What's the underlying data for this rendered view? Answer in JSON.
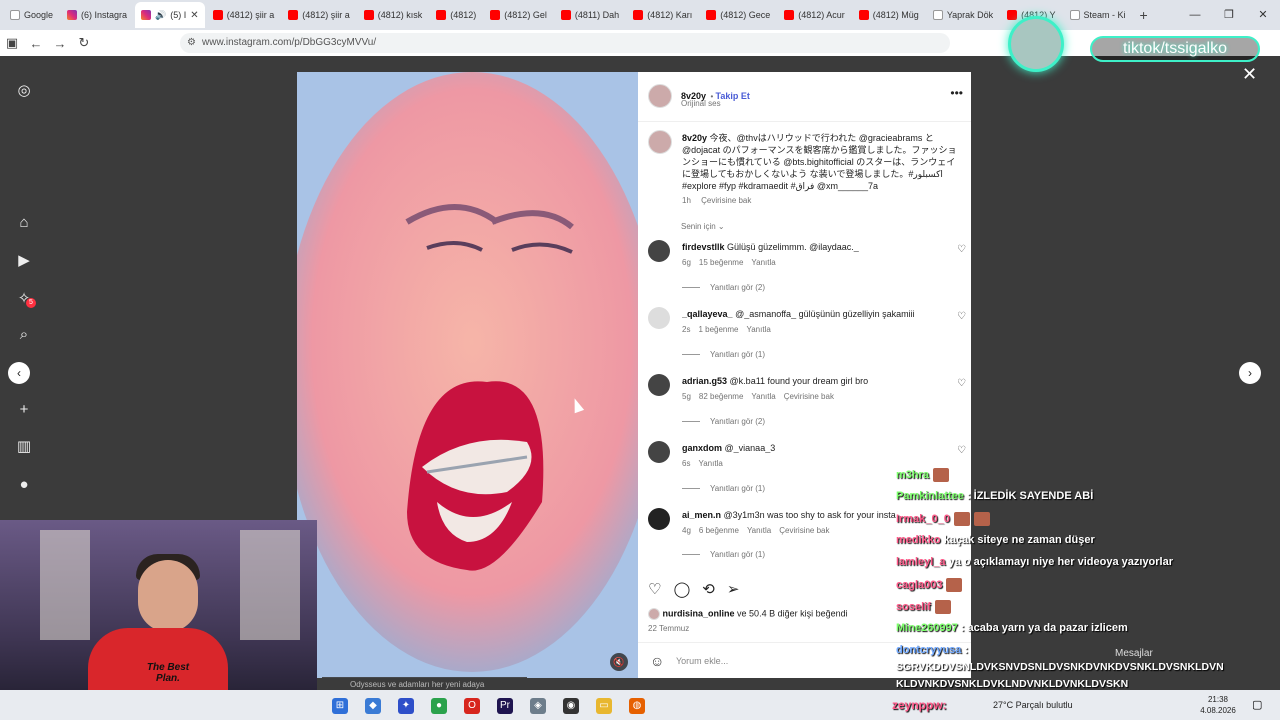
{
  "browser": {
    "tabs": [
      {
        "label": "Google",
        "icon": "google"
      },
      {
        "label": "(6) Instagra",
        "icon": "instagram"
      },
      {
        "label": "(5) I",
        "icon": "instagram",
        "active": true
      },
      {
        "label": "(4812) şiir a",
        "icon": "youtube"
      },
      {
        "label": "(4812) şiir a",
        "icon": "youtube"
      },
      {
        "label": "(4812) kısk",
        "icon": "youtube"
      },
      {
        "label": "(4812)",
        "icon": "youtube"
      },
      {
        "label": "(4812) Gel",
        "icon": "youtube"
      },
      {
        "label": "(4811) Dah",
        "icon": "youtube"
      },
      {
        "label": "(4812) Karı",
        "icon": "youtube"
      },
      {
        "label": "(4812) Gece",
        "icon": "youtube"
      },
      {
        "label": "(4812) Acur",
        "icon": "youtube"
      },
      {
        "label": "(4812) Müg",
        "icon": "youtube"
      },
      {
        "label": "Yaprak Dök",
        "icon": "web"
      },
      {
        "label": "(4812) Y",
        "icon": "youtube"
      },
      {
        "label": "Steam - Ki",
        "icon": "web"
      }
    ],
    "url": "www.instagram.com/p/DbGG3cyMVVu/"
  },
  "post": {
    "username": "8v20y",
    "follow_label": "Takip Et",
    "audio": "Orijinal ses",
    "caption_user": "8v20y",
    "caption": "今夜、@thvはハリウッドで行われた @gracieabrams と @dojacat のパフォーマンスを観客席から鑑賞しました。ファッションショーにも慣れている @bts.bighitofficial のスターは、ランウェイに登場してもおかしくないよう な装いで登場しました。#اكسبلور #explore #fyp #kdramaedit #فراق @xm______7a",
    "caption_time": "1h",
    "translate_label": "Çevirisine bak",
    "sort_label": "Senin için",
    "likes_user": "nurdisina_online",
    "likes_text": "ve 50.4 B diğer kişi beğendi",
    "date": "22 Temmuz",
    "add_comment_placeholder": "Yorum ekle..."
  },
  "comments": [
    {
      "user": "firdevstllk",
      "text": "Gülüşü güzelimmm. @ilaydaac._",
      "time": "6g",
      "likes": "15 beğenme",
      "reply": "Yanıtla",
      "translate": "",
      "replies": "Yanıtları gör (2)"
    },
    {
      "user": "_qallayeva_",
      "text": "@_asmanoffa_ gülüşünün güzelliyin şakamiii",
      "time": "2s",
      "likes": "1 beğenme",
      "reply": "Yanıtla",
      "translate": "",
      "replies": "Yanıtları gör (1)"
    },
    {
      "user": "adrian.g53",
      "text": "@k.ba11 found your dream girl bro",
      "time": "5g",
      "likes": "82 beğenme",
      "reply": "Yanıtla",
      "translate": "Çevirisine bak",
      "replies": "Yanıtları gör (2)"
    },
    {
      "user": "ganxdom",
      "text": "@_vianaa_3",
      "time": "6s",
      "likes": "",
      "reply": "Yanıtla",
      "translate": "",
      "replies": "Yanıtları gör (1)"
    },
    {
      "user": "ai_men.n",
      "text": "@3y1m3n was too shy to ask for your insta",
      "time": "4g",
      "likes": "6 beğenme",
      "reply": "Yanıtla",
      "translate": "Çevirisine bak",
      "replies": "Yanıtları gör (1)"
    }
  ],
  "stream": {
    "tiktok": "tiktok/tssigalko",
    "shirt_text": "The Best Plan.",
    "subtitle": "Odysseus ve adamları her yeni adaya",
    "chat": [
      {
        "user": "m3hra",
        "text": "",
        "color": "g"
      },
      {
        "user": "Pamkinlattee",
        "text": ": İZLEDİK SAYENDE ABİ",
        "color": "g"
      },
      {
        "user": "Irmak_0_0",
        "text": "",
        "color": "p"
      },
      {
        "user": "medikko",
        "text": "kaçak siteye ne zaman düşer",
        "color": "p"
      },
      {
        "user": "lamleyl_a",
        "text": "ya o açıklamayı niye her videoya yazıyorlar",
        "color": "p"
      },
      {
        "user": "cagla003",
        "text": "",
        "color": "p"
      },
      {
        "user": "soselif",
        "text": "",
        "color": "p"
      },
      {
        "user": "Mine260997",
        "text": ": acaba yarn ya da pazar izlicem",
        "color": "g"
      },
      {
        "user": "dontcryyusa",
        "text": ":",
        "color": "b"
      },
      {
        "user": "",
        "text": "SGRVKDDVSNLDVKSNVDSNLDVSNKDVNKDVSNKLDVSNKLDVN",
        "color": "w"
      },
      {
        "user": "",
        "text": "KLDVNKDVSNKLDVKLNDVNKLDVNKLDVSKN",
        "color": "w"
      },
      {
        "user": "zeynppw",
        "text": ":",
        "color": "p"
      }
    ]
  },
  "taskbar": {
    "weather": "27°C  Parçalı bulutlu",
    "time": "21:38",
    "date": "4.08.2026",
    "messages": "Mesajlar"
  }
}
